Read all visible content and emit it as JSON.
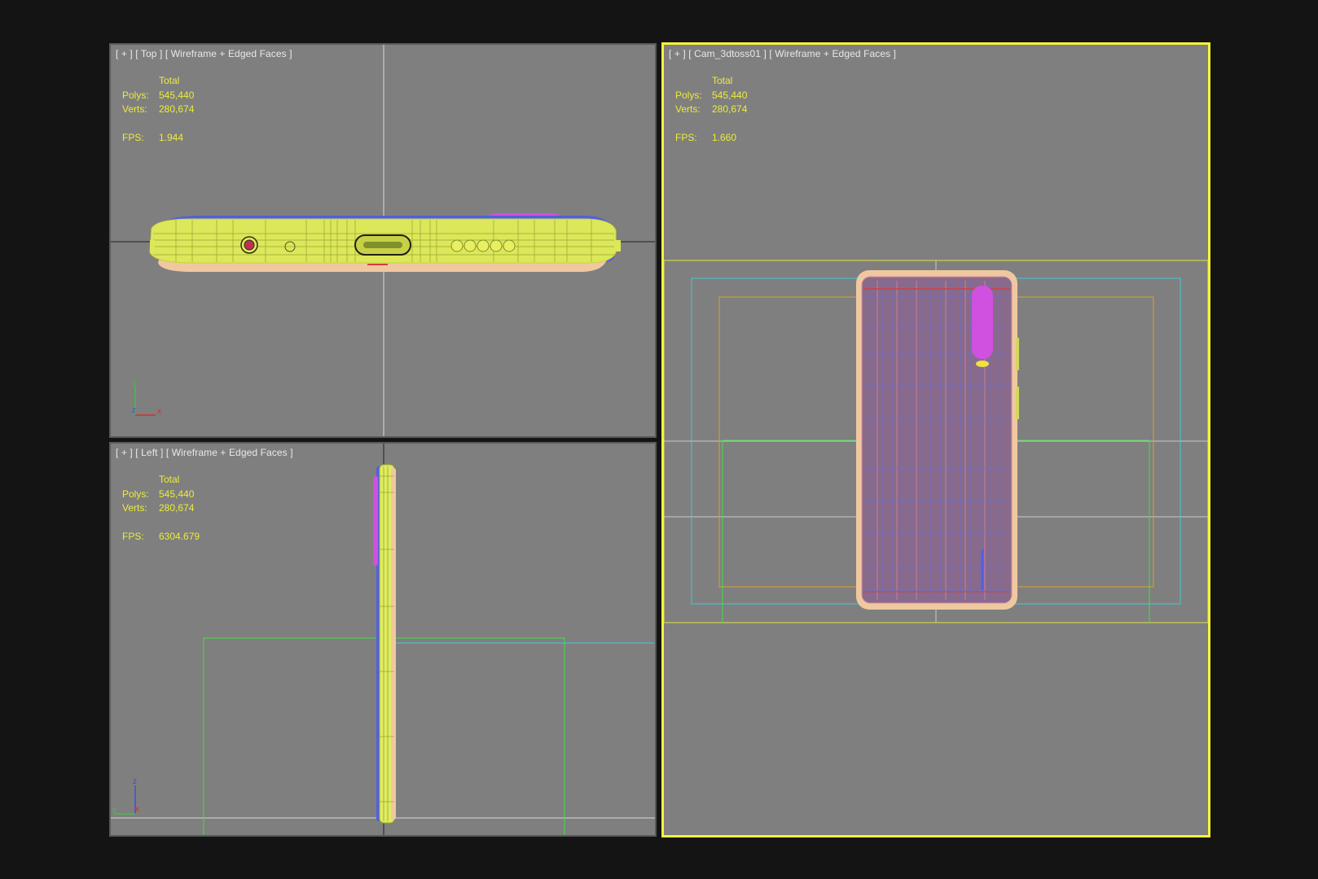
{
  "viewports": {
    "top": {
      "label": "[ + ] [ Top ] [ Wireframe + Edged Faces ]",
      "stats": {
        "total_label": "Total",
        "polys_label": "Polys:",
        "polys": "545,440",
        "verts_label": "Verts:",
        "verts": "280,674",
        "fps_label": "FPS:",
        "fps": "1.944"
      },
      "gizmo": {
        "axis1": "y",
        "axis2": "x",
        "axis3": "z"
      }
    },
    "left": {
      "label": "[ + ] [ Left ] [ Wireframe + Edged Faces ]",
      "stats": {
        "total_label": "Total",
        "polys_label": "Polys:",
        "polys": "545,440",
        "verts_label": "Verts:",
        "verts": "280,674",
        "fps_label": "FPS:",
        "fps": "6304.679"
      },
      "gizmo": {
        "axis1": "z",
        "axis2": "x",
        "axis3": "y"
      }
    },
    "camera": {
      "label": "[ + ] [ Cam_3dtoss01 ] [ Wireframe + Edged Faces ]",
      "stats": {
        "total_label": "Total",
        "polys_label": "Polys:",
        "polys": "545,440",
        "verts_label": "Verts:",
        "verts": "280,674",
        "fps_label": "FPS:",
        "fps": "1.660"
      }
    }
  },
  "colors": {
    "background": "#141414",
    "viewport": "#7f7f7f",
    "active_border": "#f4f43a",
    "stats_text": "#ecec3c",
    "label_text": "#e8e8e8",
    "wire_yellow": "#e6f05a",
    "wire_blue": "#5060e0",
    "wire_magenta": "#d050e0",
    "wire_peach": "#f0c8a0",
    "frame_cyan": "#40c8d8",
    "frame_orange": "#d8a030",
    "frame_green": "#40e040",
    "frame_yellow": "#e0e040"
  },
  "icons": {
    "top_view_object": "phone-top-wireframe",
    "left_view_object": "phone-side-wireframe",
    "camera_view_object": "phone-back-wireframe",
    "axis_gizmo": "axis-tripod-icon"
  }
}
